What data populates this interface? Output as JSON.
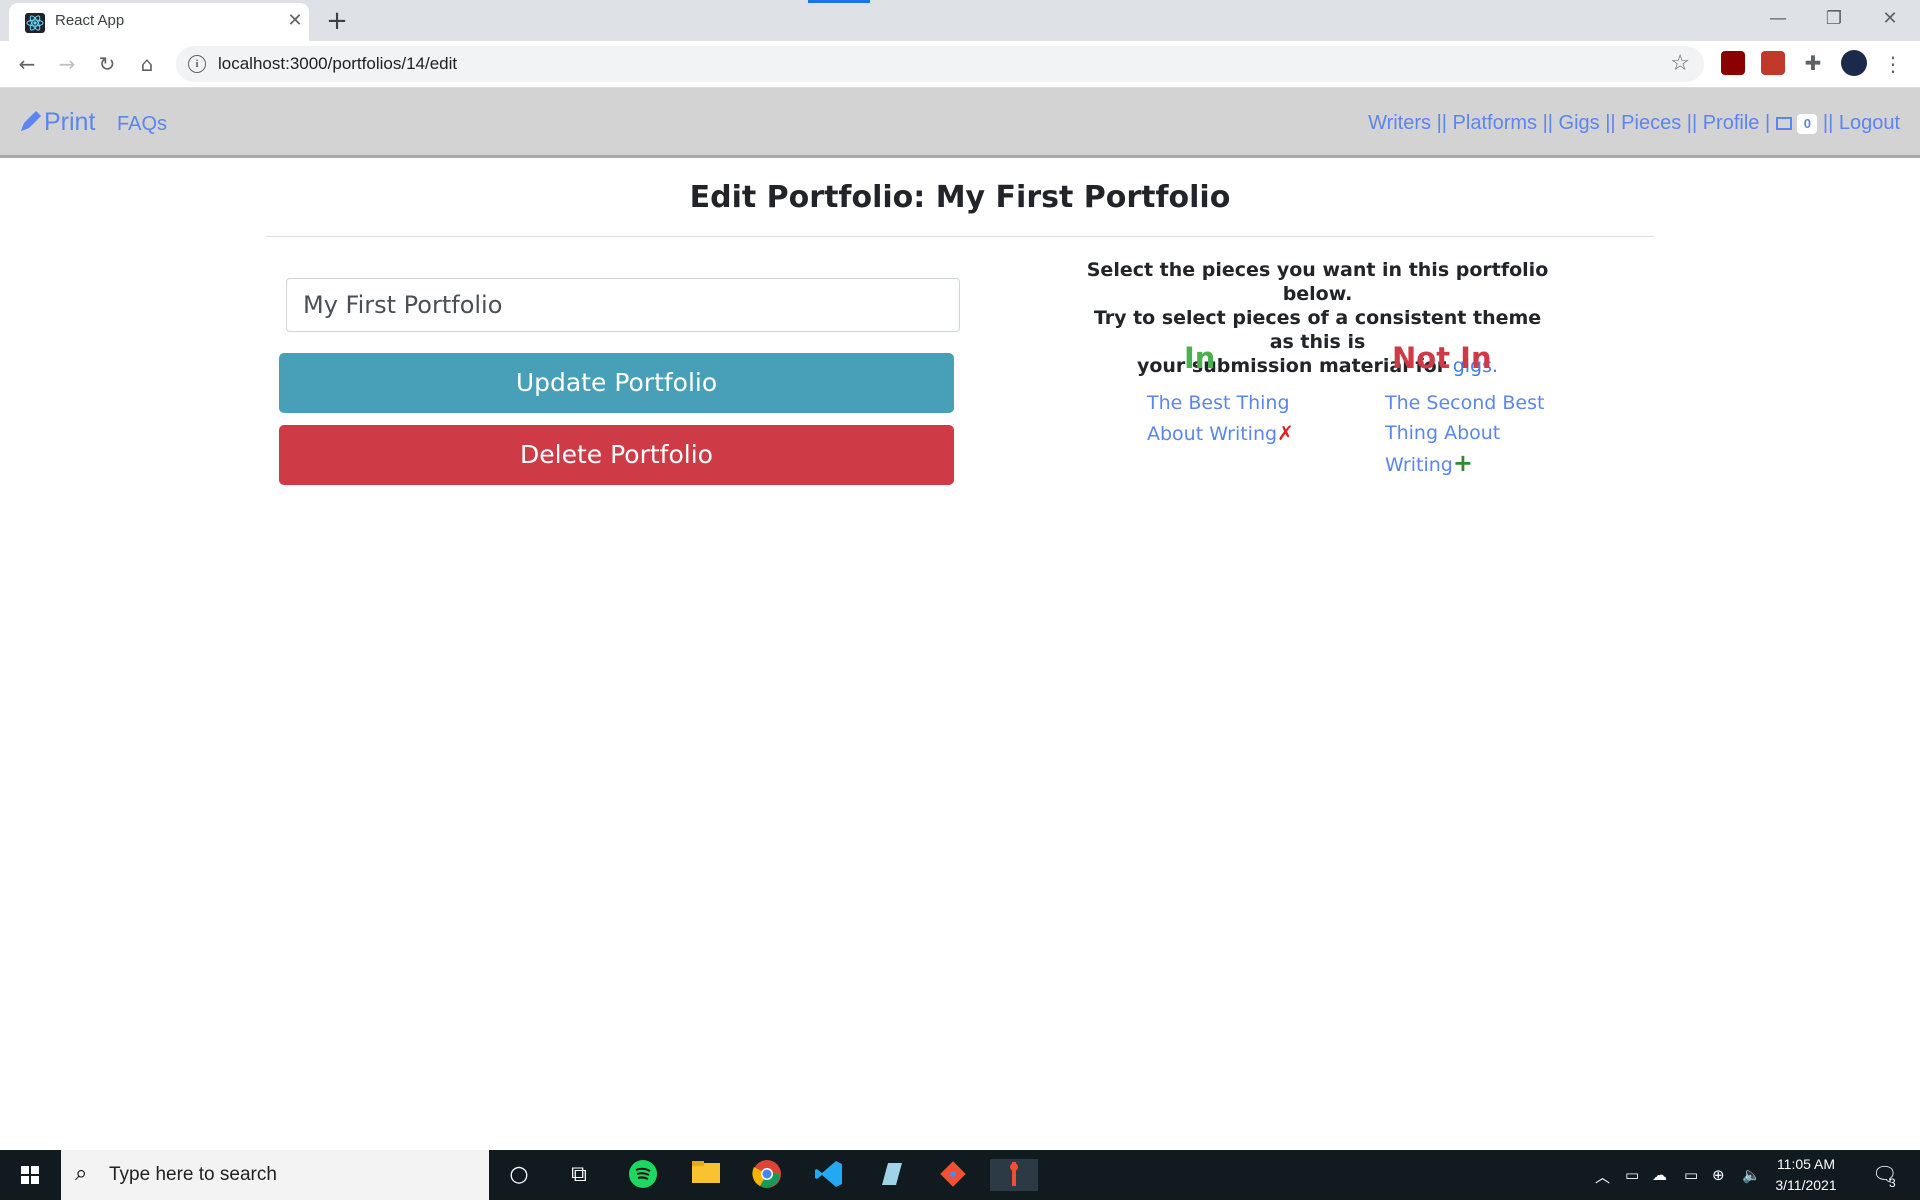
{
  "browser": {
    "tab_title": "React App",
    "url": "localhost:3000/portfolios/14/edit"
  },
  "navbar": {
    "brand": "Print",
    "faqs": "FAQs",
    "links": [
      "Writers",
      "Platforms",
      "Gigs",
      "Pieces",
      "Profile"
    ],
    "separator": "||",
    "pipe": "|",
    "mail_count": "0",
    "logout": "Logout"
  },
  "page": {
    "title": "Edit Portfolio: My First Portfolio",
    "name_input_value": "My First Portfolio",
    "update_button": "Update Portfolio",
    "delete_button": "Delete Portfolio",
    "instructions_line1": "Select the pieces you want in this portfolio below.",
    "instructions_line2": "Try to select pieces of a consistent theme as this is",
    "instructions_line3": "your submission material for",
    "gigs_link": "gigs.",
    "in_heading": "In",
    "not_in_heading": "Not In",
    "in_pieces": [
      "The Best Thing About Writing"
    ],
    "not_in_pieces": [
      "The Second Best Thing About Writing"
    ]
  },
  "taskbar": {
    "search_placeholder": "Type here to search",
    "time": "11:05 AM",
    "date": "3/11/2021",
    "notification_count": "3"
  },
  "colors": {
    "link": "#5b85f0",
    "update": "#48a0b8",
    "delete": "#cf3a47",
    "in_green": "#4caf50",
    "nav_bg": "#d3d3d3"
  }
}
